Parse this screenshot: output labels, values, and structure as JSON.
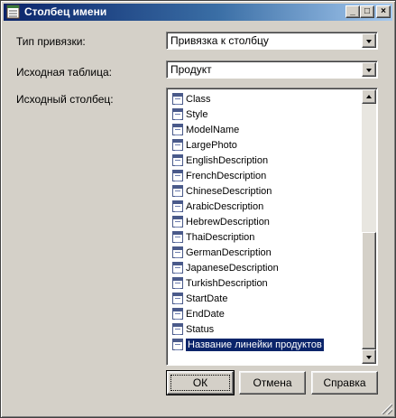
{
  "window": {
    "title": "Столбец имени",
    "icon": "table-column-icon",
    "controls": {
      "minimize": "_",
      "maximize": "□",
      "close": "×"
    }
  },
  "form": {
    "binding_type": {
      "label": "Тип привязки:",
      "value": "Привязка к столбцу"
    },
    "source_table": {
      "label": "Исходная таблица:",
      "value": "Продукт"
    },
    "source_column": {
      "label": "Исходный столбец:",
      "items": [
        "Class",
        "Style",
        "ModelName",
        "LargePhoto",
        "EnglishDescription",
        "FrenchDescription",
        "ChineseDescription",
        "ArabicDescription",
        "HebrewDescription",
        "ThaiDescription",
        "GermanDescription",
        "JapaneseDescription",
        "TurkishDescription",
        "StartDate",
        "EndDate",
        "Status",
        "Название линейки продуктов"
      ],
      "selected_index": 16
    }
  },
  "buttons": {
    "ok": "ОК",
    "cancel": "Отмена",
    "help": "Справка"
  },
  "colors": {
    "selection": "#0a246a",
    "titlebar": "#0a246a",
    "face": "#d4d0c8"
  }
}
